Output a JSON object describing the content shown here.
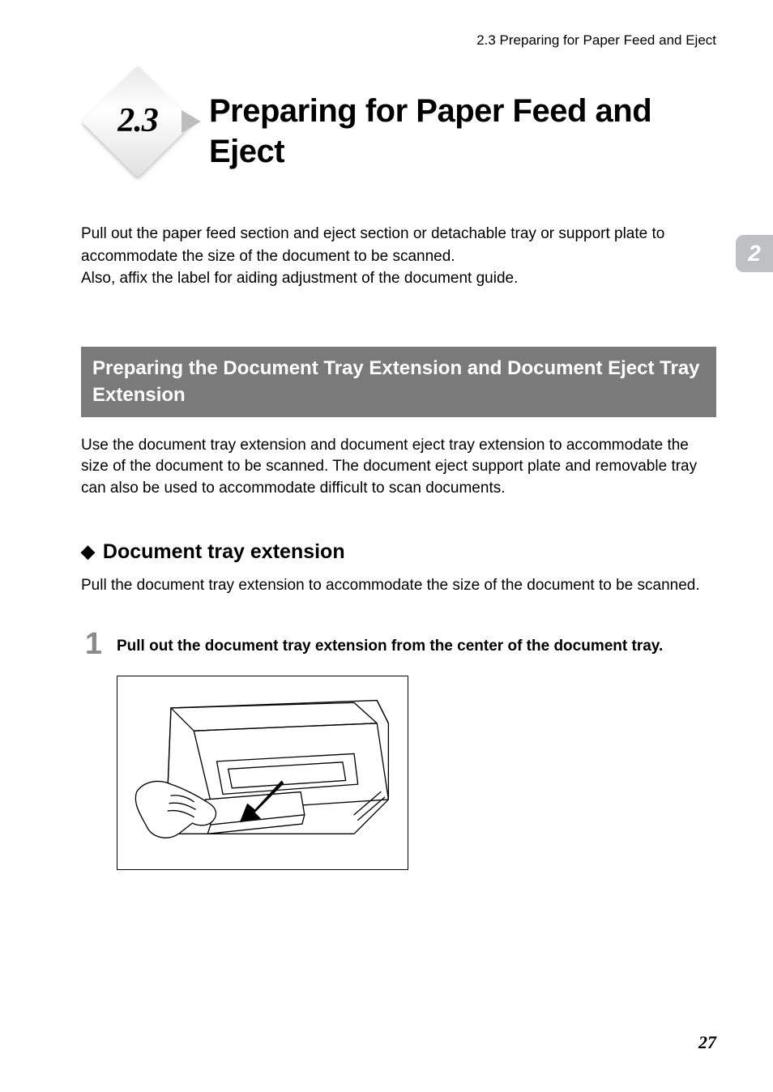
{
  "running_head": "2.3   Preparing for Paper Feed and Eject",
  "chapter_tab": "2",
  "diamond_number": "2.3",
  "main_title": "Preparing for Paper Feed and Eject",
  "intro_p1": "Pull out the paper feed section and eject section or detachable tray or support plate to accommodate the size of the document to be scanned.",
  "intro_p2": "Also, affix the label for aiding adjustment of the document guide.",
  "section_bar": "Preparing the Document Tray Extension and Document Eject Tray Extension",
  "section_body": "Use the document tray extension and document eject tray extension to accommodate the size of the document to be scanned. The document eject support plate and removable tray can also be used to accommodate difficult to scan documents.",
  "subsection_title": "Document tray extension",
  "subsection_body": "Pull the document tray extension to accommodate the size of the document to be scanned.",
  "step1_num": "1",
  "step1_text": "Pull out the document tray extension from the center of the document tray.",
  "page_number": "27"
}
